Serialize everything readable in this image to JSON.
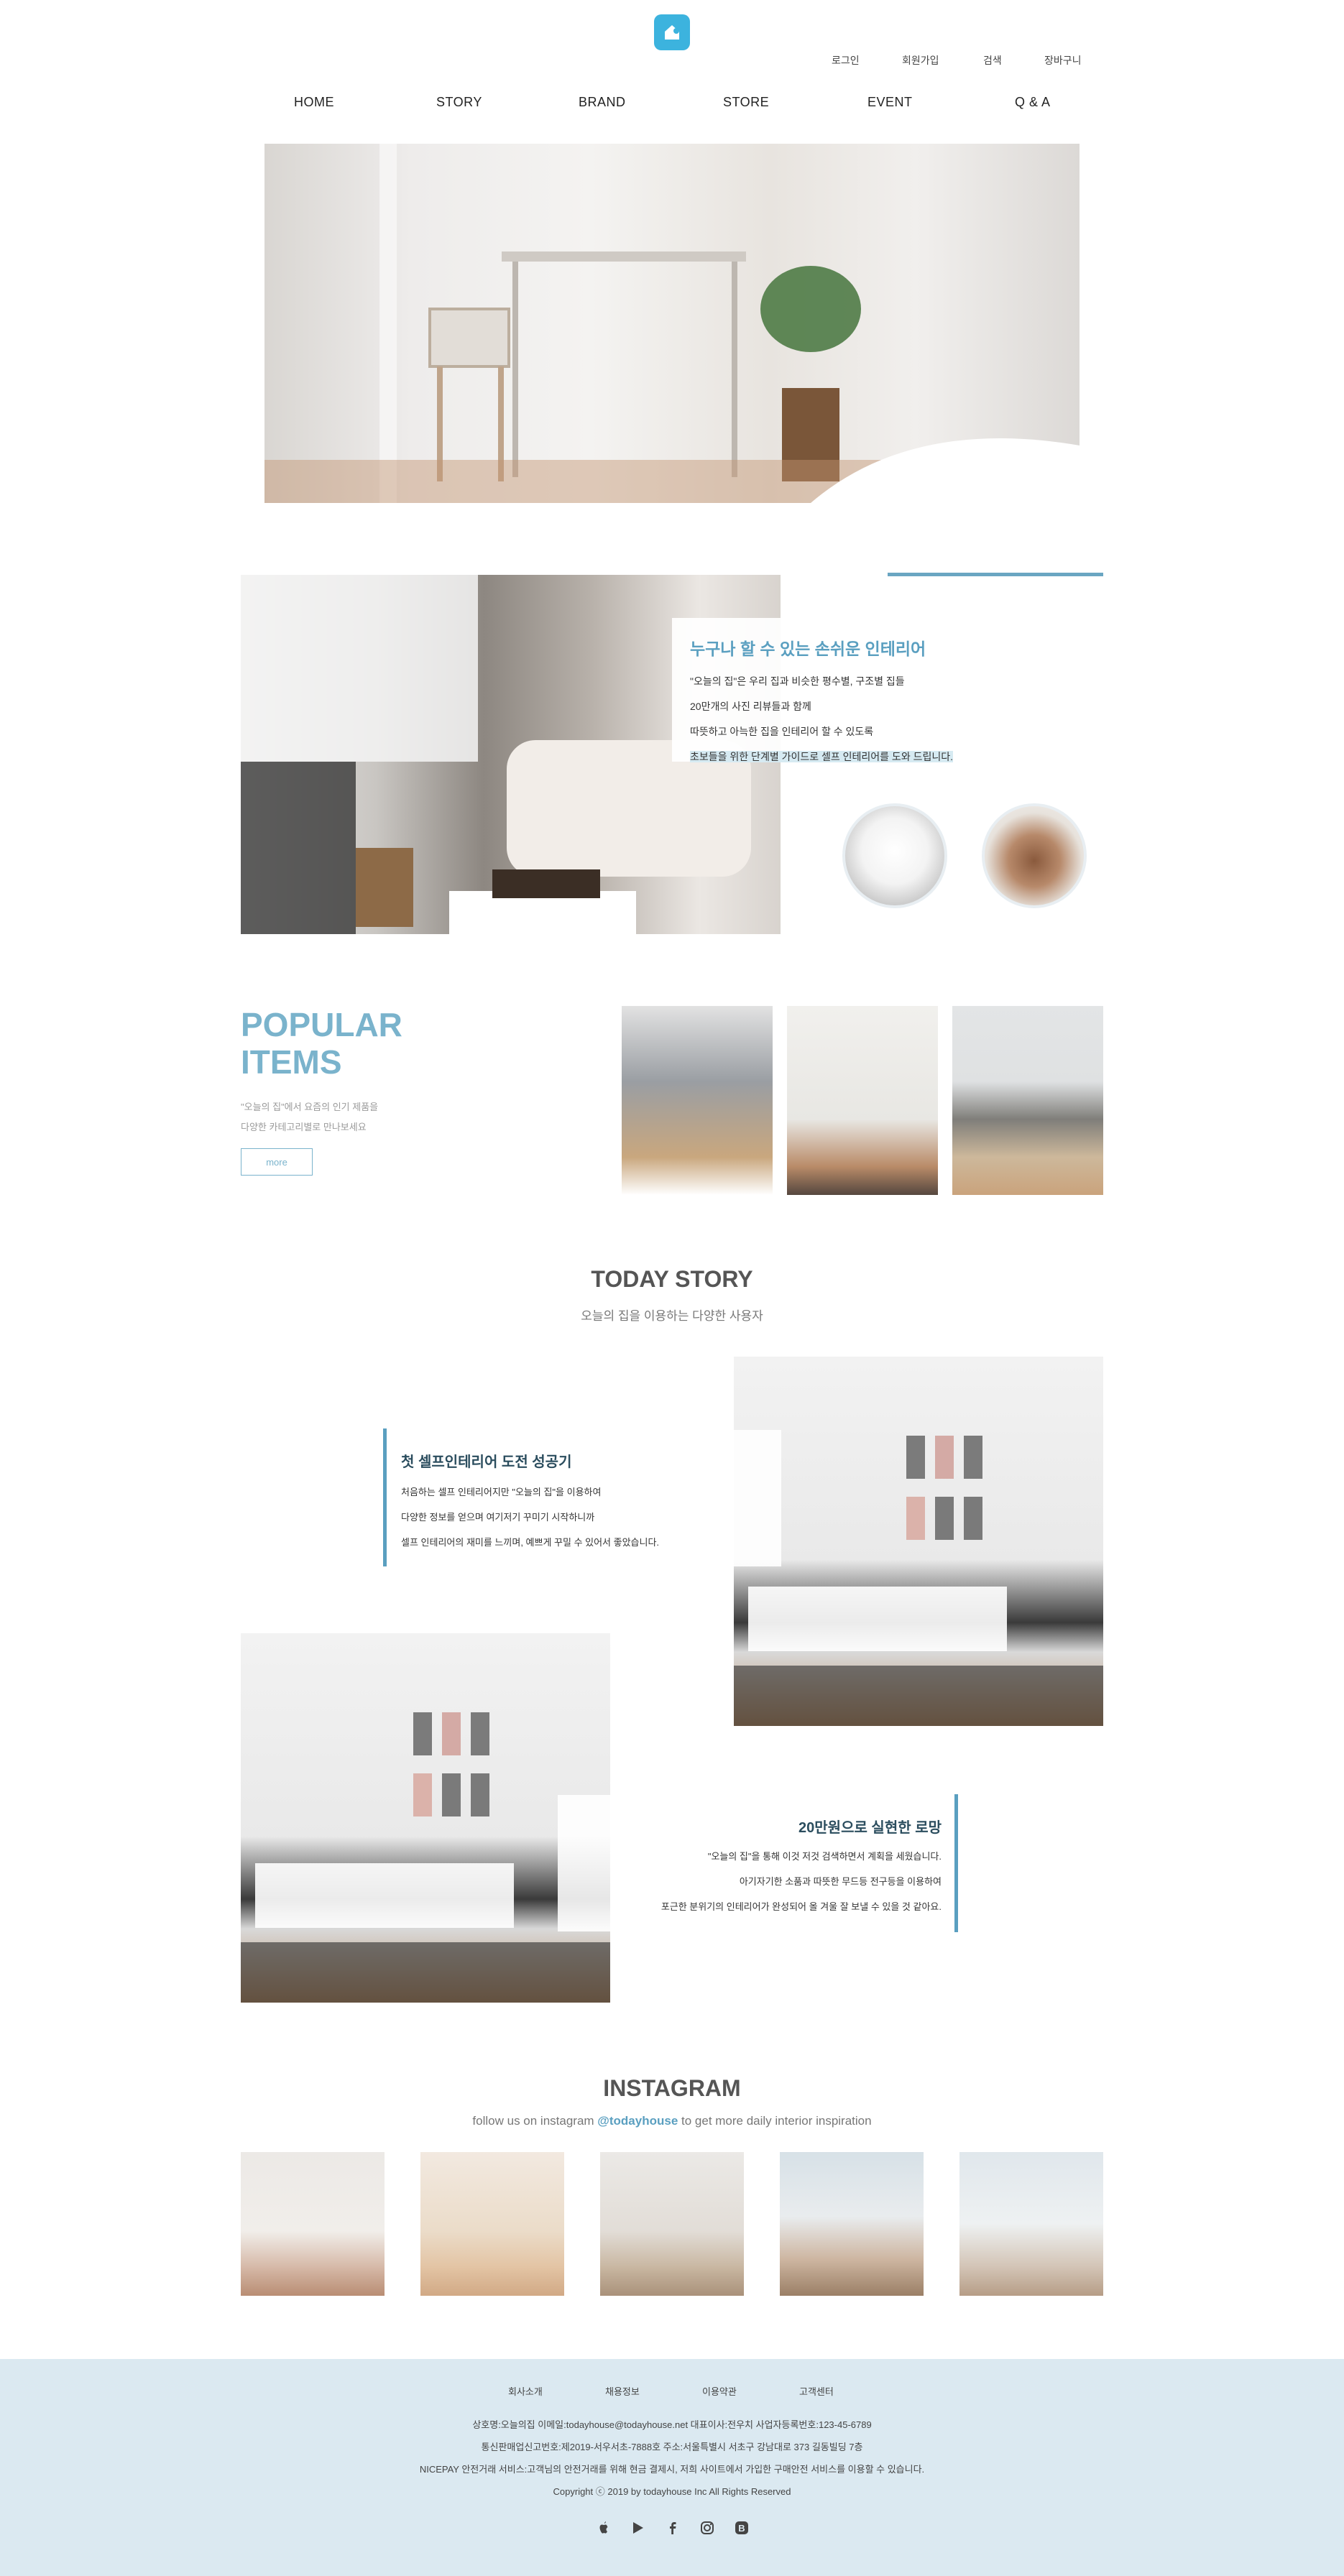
{
  "header": {
    "util_links": [
      "로그인",
      "회원가입",
      "검색",
      "장바구니"
    ],
    "nav": [
      "HOME",
      "STORY",
      "BRAND",
      "STORE",
      "EVENT",
      "Q & A"
    ]
  },
  "about": {
    "title": "누구나 할 수 있는 손쉬운 인테리어",
    "lines": [
      "\"오늘의 집\"은 우리 집과 비슷한 평수별, 구조별 집들",
      "20만개의 사진 리뷰들과 함께",
      "따뜻하고 아늑한 집을 인테리어 할 수 있도록",
      "초보들을 위한 단계별 가이드로 셀프 인테리어를 도와 드립니다."
    ]
  },
  "popular": {
    "title_line1": "POPULAR",
    "title_line2": "ITEMS",
    "desc_line1": "\"오늘의 집\"에서 요즘의 인기 제품을",
    "desc_line2": "다양한 카테고리별로 만나보세요",
    "more_label": "more"
  },
  "story": {
    "title": "TODAY STORY",
    "subtitle": "오늘의 집을 이용하는 다양한 사용자",
    "item1": {
      "title": "첫 셀프인테리어 도전 성공기",
      "lines": [
        "처음하는 셀프 인테리어지만 \"오늘의 집\"을 이용하여",
        "다양한 정보를 얻으며 여기저기 꾸미기 시작하니까",
        "셀프 인테리어의 재미를 느끼며, 예쁘게 꾸밀 수 있어서 좋았습니다."
      ]
    },
    "item2": {
      "title": "20만원으로 실현한 로망",
      "lines": [
        "\"오늘의 집\"을 통해 이것 저것 검색하면서 계획을 세웠습니다.",
        "아기자기한 소품과 따뜻한 무드등 전구등을 이용하여",
        "포근한 분위기의 인테리어가 완성되어 올 겨울 잘 보낼 수 있을 것 같아요."
      ]
    }
  },
  "instagram": {
    "title": "INSTAGRAM",
    "sub_before": "follow us on instagram ",
    "handle": "@todayhouse",
    "sub_after": " to get more daily interior inspiration"
  },
  "footer": {
    "links": [
      "회사소개",
      "채용정보",
      "이용약관",
      "고객센터"
    ],
    "info": [
      "상호명:오늘의집 이메일:todayhouse@todayhouse.net 대표이사:전우치 사업자등록번호:123-45-6789",
      "통신판매업신고번호:제2019-서우서초-7888호 주소:서울특별시 서초구 강남대로 373 길동빌딩 7층",
      "NICEPAY 안전거래 서비스:고객님의 안전거래를 위해 현금 결제시, 저희 사이트에서 가입한 구매안전 서비스를 이용할 수 있습니다.",
      "Copyright ⓒ 2019 by todayhouse Inc All Rights Reserved"
    ],
    "sns_icons": [
      "apple-icon",
      "play-store-icon",
      "facebook-icon",
      "instagram-icon",
      "blog-icon"
    ]
  },
  "colors": {
    "accent": "#5a9fc0",
    "logo": "#3cb3de",
    "footer_bg": "#dbe9f1"
  }
}
